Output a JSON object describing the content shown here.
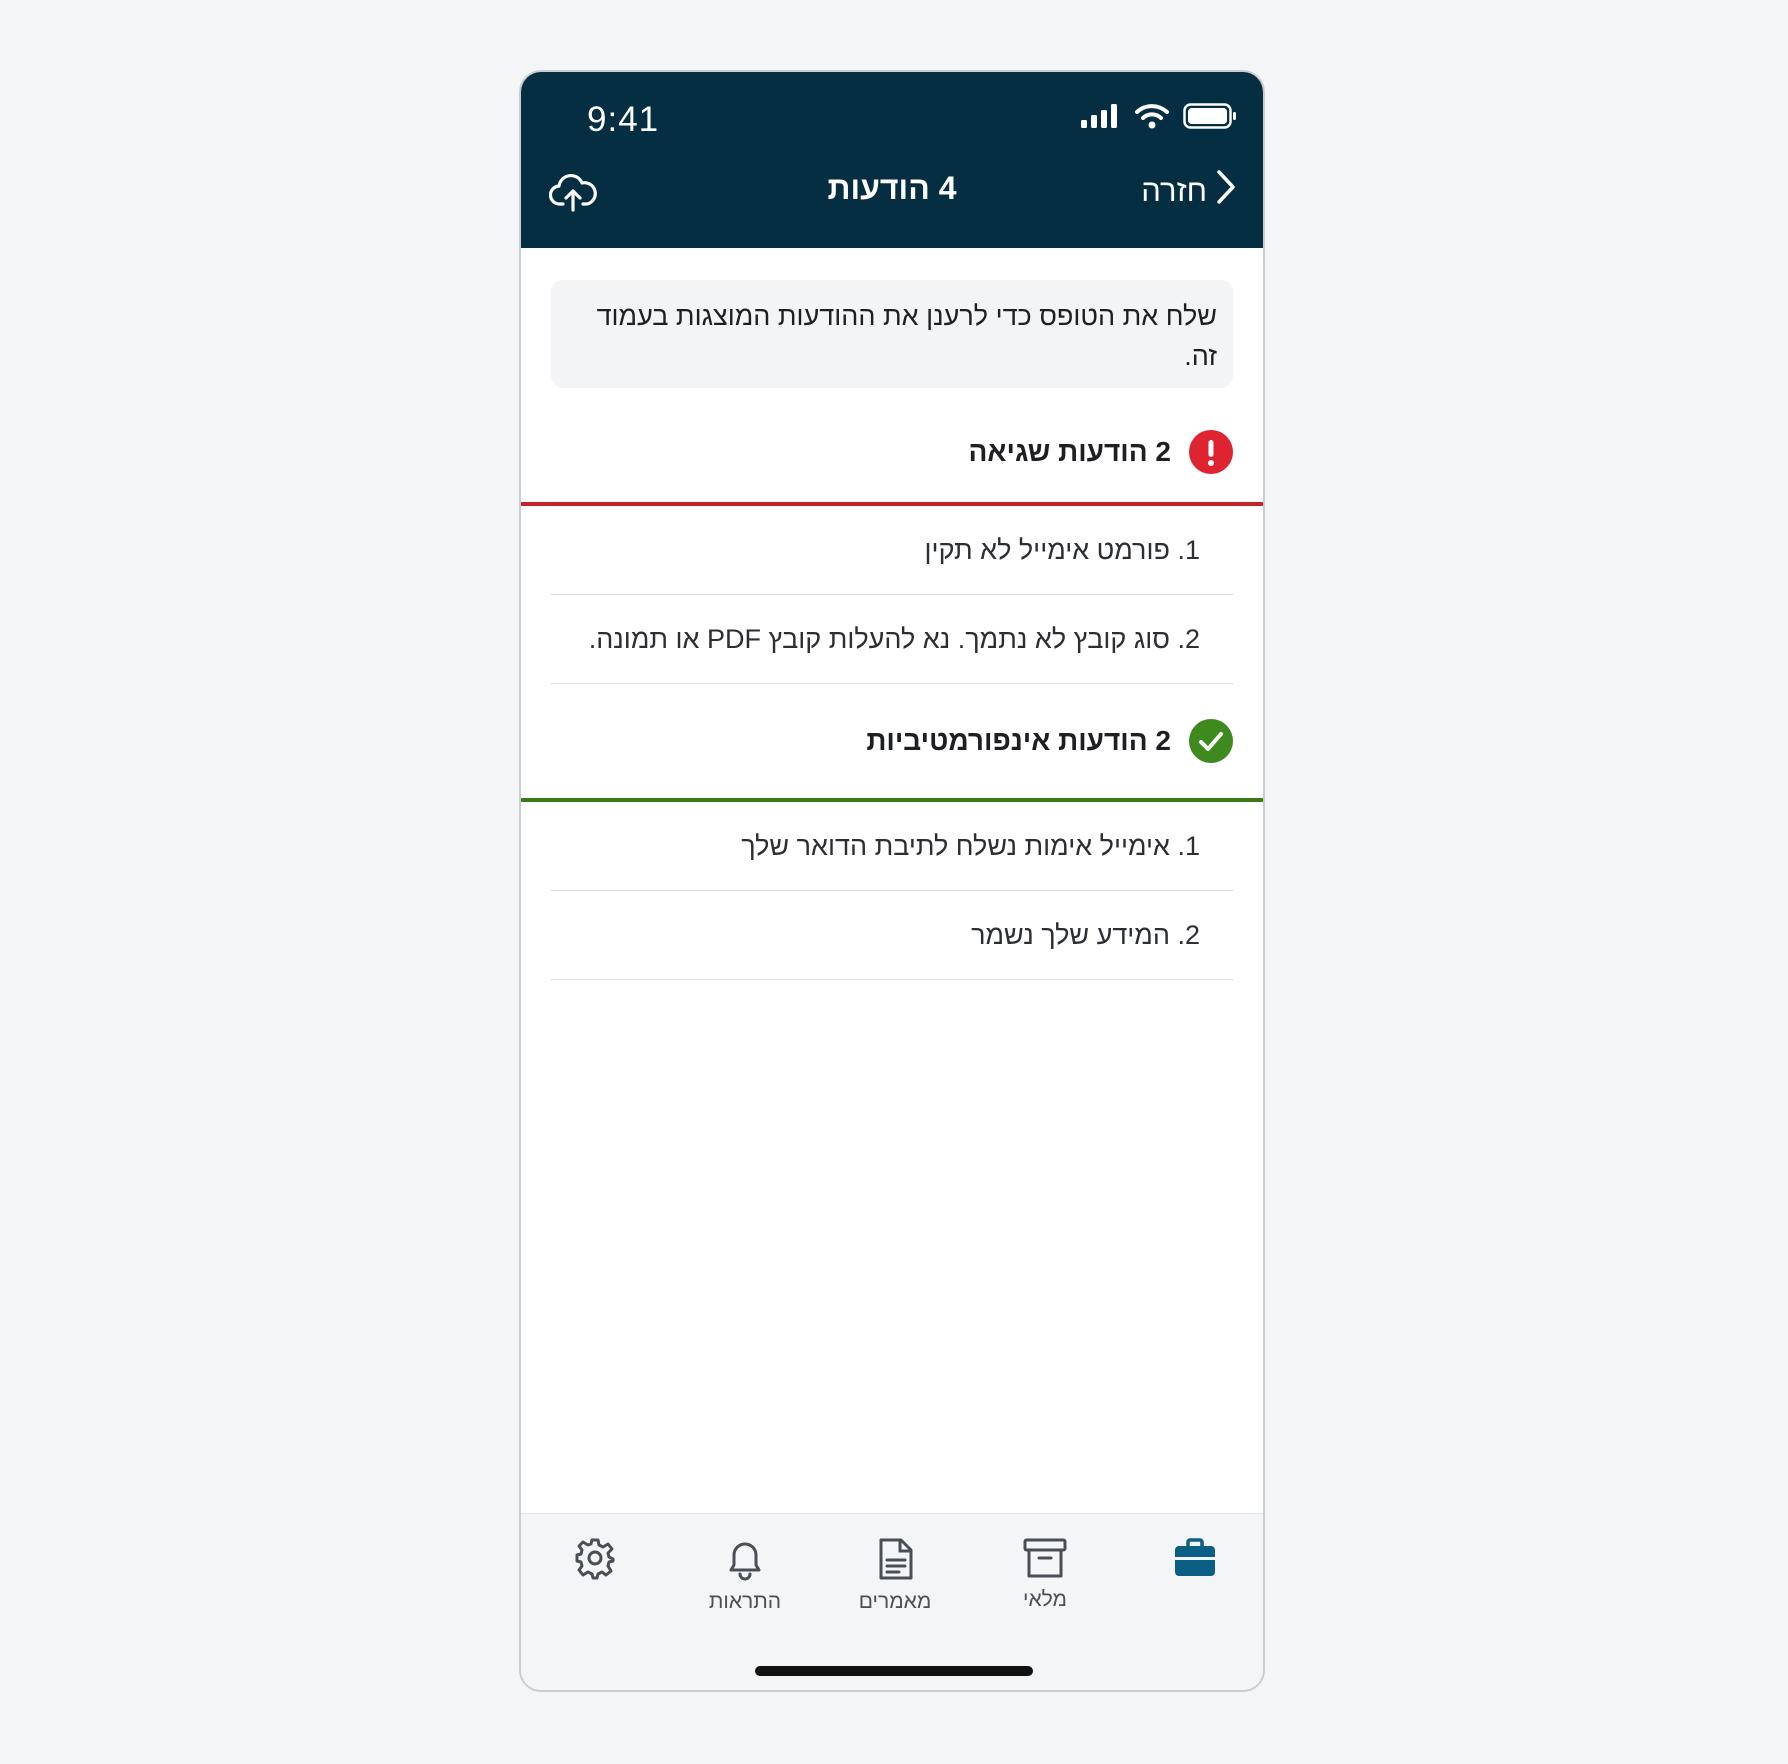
{
  "status_bar": {
    "time": "9:41",
    "icons": [
      "signal-icon",
      "wifi-icon",
      "battery-icon"
    ]
  },
  "nav": {
    "title": "4 הודעות",
    "back_label": "חזרה",
    "upload_icon": "cloud-upload-icon"
  },
  "info": {
    "text": "שלח את הטופס כדי לרענן את ההודעות המוצגות בעמוד זה."
  },
  "error_section": {
    "title": "2 הודעות שגיאה",
    "color": "#de2430",
    "items": [
      {
        "label": "1. פורמט אימייל לא תקין"
      },
      {
        "label": "2. סוג קובץ לא נתמך. נא להעלות קובץ PDF או תמונה."
      }
    ]
  },
  "info_section": {
    "title": "2 הודעות אינפורמטיביות",
    "color": "#3f8a1e",
    "items": [
      {
        "label": "1. אימייל אימות נשלח לתיבת הדואר שלך"
      },
      {
        "label": "2. המידע שלך נשמר"
      }
    ]
  },
  "tabs": [
    {
      "icon": "briefcase-icon",
      "label": "",
      "active": true,
      "color": "#0b5f84"
    },
    {
      "icon": "archive-icon",
      "label": "מלאי"
    },
    {
      "icon": "document-icon",
      "label": "מאמרים"
    },
    {
      "icon": "bell-icon",
      "label": "התראות"
    },
    {
      "icon": "gear-icon",
      "label": ""
    }
  ],
  "colors": {
    "header_bg": "#052e42",
    "accent": "#0b5f84"
  }
}
